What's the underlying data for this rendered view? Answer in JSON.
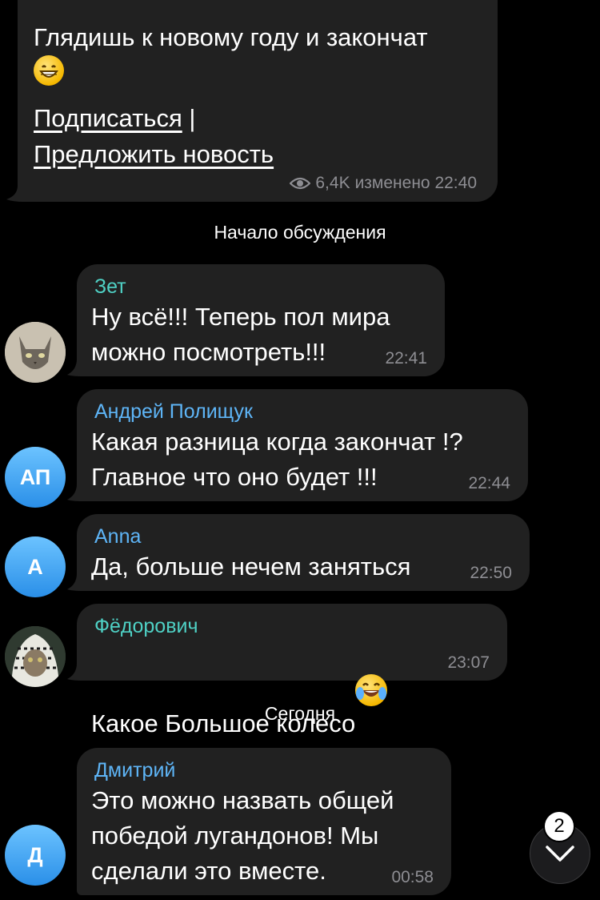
{
  "post": {
    "text": "Глядишь к новому году и закончат",
    "link_subscribe": "Подписаться",
    "separator": "|",
    "link_suggest": "Предложить новость",
    "views": "6,4K",
    "edited": "изменено 22:40"
  },
  "discussion_label": "Начало обсуждения",
  "messages": [
    {
      "sender": "Зет",
      "sender_color": "#4fd1c5",
      "text": "Ну всё!!! Теперь пол мира\nможно посмотреть!!!",
      "time": "22:41"
    },
    {
      "sender": "Андрей Полищук",
      "sender_color": "#5eb5f7",
      "avatar_initials": "АП",
      "text": "Какая разница когда закончат !?\nГлавное что оно будет !!!",
      "time": "22:44"
    },
    {
      "sender": "Anna",
      "sender_color": "#5eb5f7",
      "avatar_initials": "А",
      "text": "Да, больше нечем заняться",
      "time": "22:50"
    },
    {
      "sender": "Фёдорович",
      "sender_color": "#4fd1c5",
      "text": "Какое Большое колесо",
      "time": "23:07"
    },
    {
      "sender": "Дмитрий",
      "sender_color": "#5eb5f7",
      "avatar_initials": "Д",
      "text": "Это можно назвать общей\nпобедой лугандонов! Мы\nсделали это вместе.",
      "time": "00:58"
    }
  ],
  "today_label": "Сегодня",
  "scroll_badge": "2"
}
